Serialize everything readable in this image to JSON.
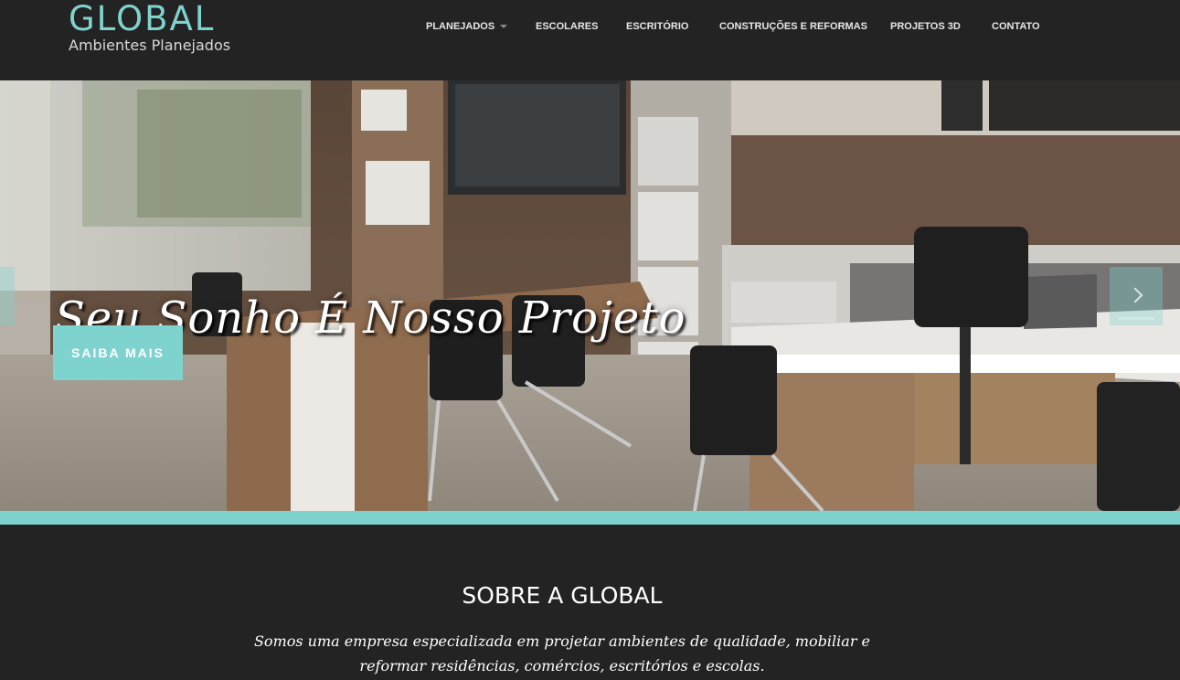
{
  "brand": {
    "name": "GLOBAL",
    "tagline": "Ambientes Planejados"
  },
  "nav": {
    "items": [
      {
        "label": "PLANEJADOS",
        "has_dropdown": true
      },
      {
        "label": "ESCOLARES"
      },
      {
        "label": "ESCRITÓRIO"
      },
      {
        "label": "CONSTRUÇÕES E REFORMAS"
      },
      {
        "label": "PROJETOS 3D"
      },
      {
        "label": "CONTATO"
      }
    ]
  },
  "hero": {
    "headline": "Seu Sonho É Nosso Projeto",
    "cta_label": "SAIBA MAIS",
    "prev_icon": "chevron-left-icon",
    "next_icon": "chevron-right-icon"
  },
  "about": {
    "title": "SOBRE A GLOBAL",
    "text": "Somos uma empresa especializada em projetar ambientes de qualidade, mobiliar e reformar residências, comércios, escritórios e escolas."
  },
  "colors": {
    "accent": "#7fd3cf",
    "background": "#232323",
    "text": "#ffffff"
  }
}
